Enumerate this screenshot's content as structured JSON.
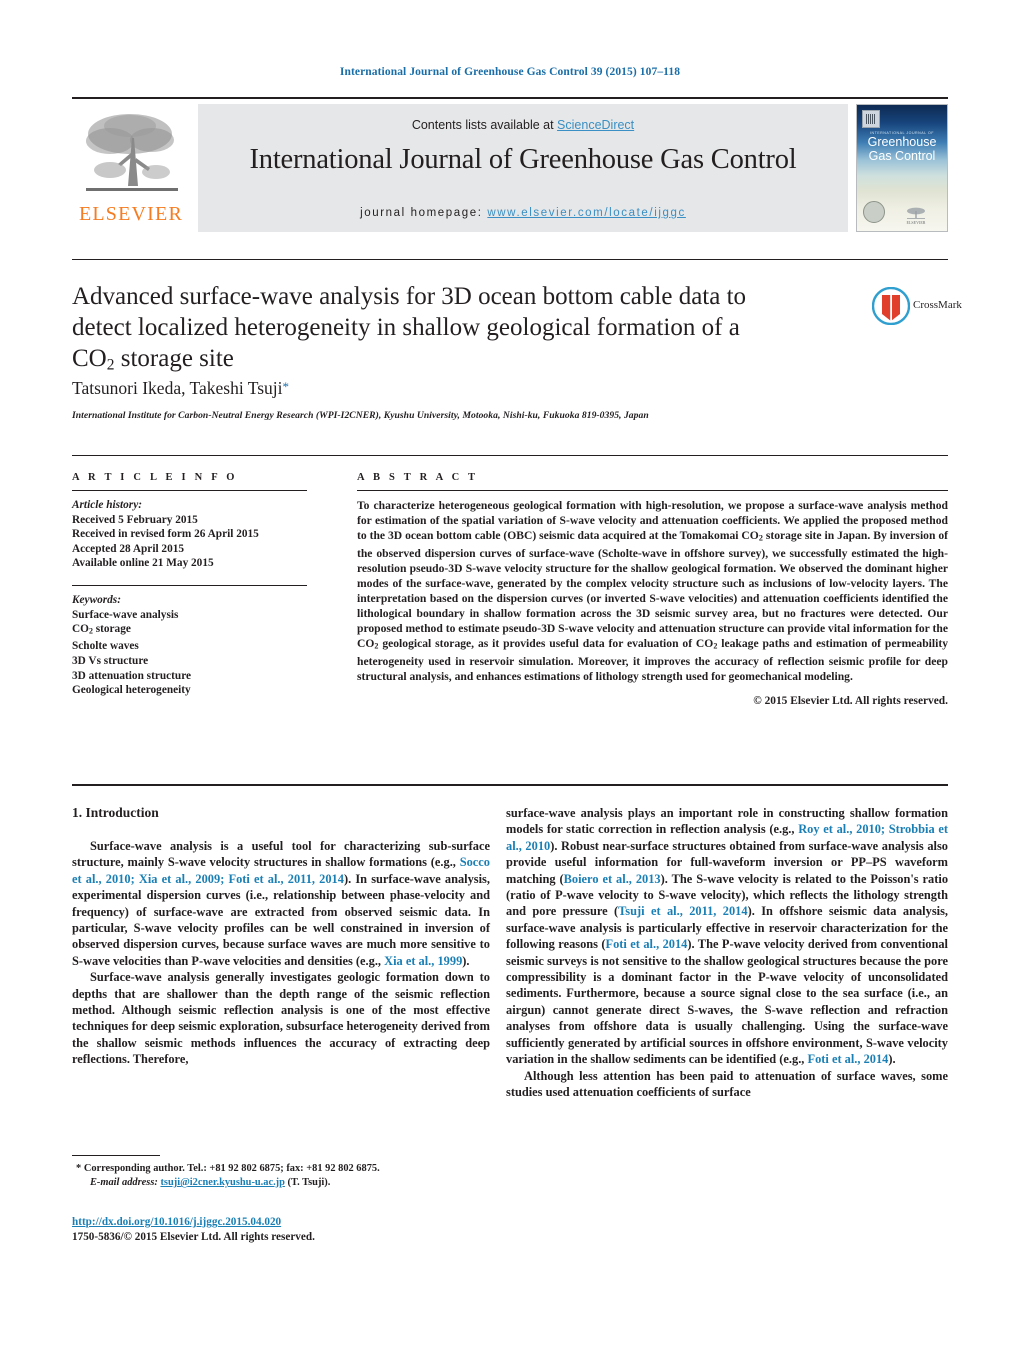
{
  "running_head": "International Journal of Greenhouse Gas Control 39 (2015) 107–118",
  "masthead": {
    "publisher_name": "ELSEVIER",
    "publisher_logo_icon": "elsevier-tree-icon",
    "contents_prefix": "Contents lists available at ",
    "contents_link": "ScienceDirect",
    "journal_name": "International Journal of Greenhouse Gas Control",
    "homepage_label": "journal homepage: ",
    "homepage_url": "www.elsevier.com/locate/ijggc",
    "cover": {
      "kicker": "INTERNATIONAL JOURNAL OF",
      "line1": "Greenhouse",
      "line2": "Gas Control",
      "publisher_mark": "ELSEVIER"
    },
    "colors": {
      "link": "#3a8fc4",
      "running_head": "#1a6ea8",
      "band_bg": "#e6e7e8",
      "elsevier_orange": "#f57c20",
      "reference_link": "#1a7fb5"
    }
  },
  "title": {
    "line1": "Advanced surface-wave analysis for 3D ocean bottom cable data to",
    "line2": "detect localized heterogeneity in shallow geological formation of a",
    "line3_pre": "CO",
    "line3_sub": "2",
    "line3_post": " storage site"
  },
  "crossmark": {
    "label": "CrossMark",
    "icon": "crossmark-icon"
  },
  "authors": {
    "names": "Tatsunori Ikeda, Takeshi Tsuji",
    "corresponding_marker": "*"
  },
  "affiliation": "International Institute for Carbon-Neutral Energy Research (WPI-I2CNER), Kyushu University, Motooka, Nishi-ku, Fukuoka 819-0395, Japan",
  "article_info": {
    "heading": "A R T I C L E   I N F O",
    "history_label": "Article history:",
    "history": [
      "Received 5 February 2015",
      "Received in revised form 26 April 2015",
      "Accepted 28 April 2015",
      "Available online 21 May 2015"
    ],
    "keywords_label": "Keywords:",
    "keywords": [
      "Surface-wave analysis",
      "CO2 storage",
      "Scholte waves",
      "3D Vs structure",
      "3D attenuation structure",
      "Geological heterogeneity"
    ]
  },
  "abstract": {
    "heading": "A B S T R A C T",
    "text": "To characterize heterogeneous geological formation with high-resolution, we propose a surface-wave analysis method for estimation of the spatial variation of S-wave velocity and attenuation coefficients. We applied the proposed method to the 3D ocean bottom cable (OBC) seismic data acquired at the Tomakomai CO2 storage site in Japan. By inversion of the observed dispersion curves of surface-wave (Scholte-wave in offshore survey), we successfully estimated the high-resolution pseudo-3D S-wave velocity structure for the shallow geological formation. We observed the dominant higher modes of the surface-wave, generated by the complex velocity structure such as inclusions of low-velocity layers. The interpretation based on the dispersion curves (or inverted S-wave velocities) and attenuation coefficients identified the lithological boundary in shallow formation across the 3D seismic survey area, but no fractures were detected. Our proposed method to estimate pseudo-3D S-wave velocity and attenuation structure can provide vital information for the CO2 geological storage, as it provides useful data for evaluation of CO2 leakage paths and estimation of permeability heterogeneity used in reservoir simulation. Moreover, it improves the accuracy of reflection seismic profile for deep structural analysis, and enhances estimations of lithology strength used for geomechanical modeling.",
    "copyright": "© 2015 Elsevier Ltd. All rights reserved."
  },
  "body": {
    "section_number_title": "1.  Introduction",
    "left_paragraphs": [
      "Surface-wave analysis is a useful tool for characterizing sub-surface structure, mainly S-wave velocity structures in shallow formations (e.g., Socco et al., 2010; Xia et al., 2009; Foti et al., 2011, 2014). In surface-wave analysis, experimental dispersion curves (i.e., relationship between phase-velocity and frequency) of surface-wave are extracted from observed seismic data. In particular, S-wave velocity profiles can be well constrained in inversion of observed dispersion curves, because surface waves are much more sensitive to S-wave velocities than P-wave velocities and densities (e.g., Xia et al., 1999).",
      "Surface-wave analysis generally investigates geologic formation down to depths that are shallower than the depth range of the seismic reflection method. Although seismic reflection analysis is one of the most effective techniques for deep seismic exploration, subsurface heterogeneity derived from the shallow seismic methods influences the accuracy of extracting deep reflections. Therefore,"
    ],
    "right_paragraphs": [
      "surface-wave analysis plays an important role in constructing shallow formation models for static correction in reflection analysis (e.g., Roy et al., 2010; Strobbia et al., 2010). Robust near-surface structures obtained from surface-wave analysis also provide useful information for full-waveform inversion or PP–PS waveform matching (Boiero et al., 2013). The S-wave velocity is related to the Poisson's ratio (ratio of P-wave velocity to S-wave velocity), which reflects the lithology strength and pore pressure (Tsuji et al., 2011, 2014). In offshore seismic data analysis, surface-wave analysis is particularly effective in reservoir characterization for the following reasons (Foti et al., 2014). The P-wave velocity derived from conventional seismic surveys is not sensitive to the shallow geological structures because the pore compressibility is a dominant factor in the P-wave velocity of unconsolidated sediments. Furthermore, because a source signal close to the sea surface (i.e., an airgun) cannot generate direct S-waves, the S-wave reflection and refraction analyses from offshore data is usually challenging. Using the surface-wave sufficiently generated by artificial sources in offshore environment, S-wave velocity variation in the shallow sediments can be identified (e.g., Foti et al., 2014).",
      "Although less attention has been paid to attenuation of surface waves, some studies used attenuation coefficients of surface"
    ]
  },
  "footnote": {
    "marker": "*",
    "corresponding": "Corresponding author. Tel.: +81 92 802 6875; fax: +81 92 802 6875.",
    "email_label": "E-mail address:",
    "email": "tsuji@i2cner.kyushu-u.ac.jp",
    "email_suffix": "(T. Tsuji)."
  },
  "footer": {
    "doi_url": "http://dx.doi.org/10.1016/j.ijggc.2015.04.020",
    "issn_line": "1750-5836/© 2015 Elsevier Ltd. All rights reserved."
  }
}
